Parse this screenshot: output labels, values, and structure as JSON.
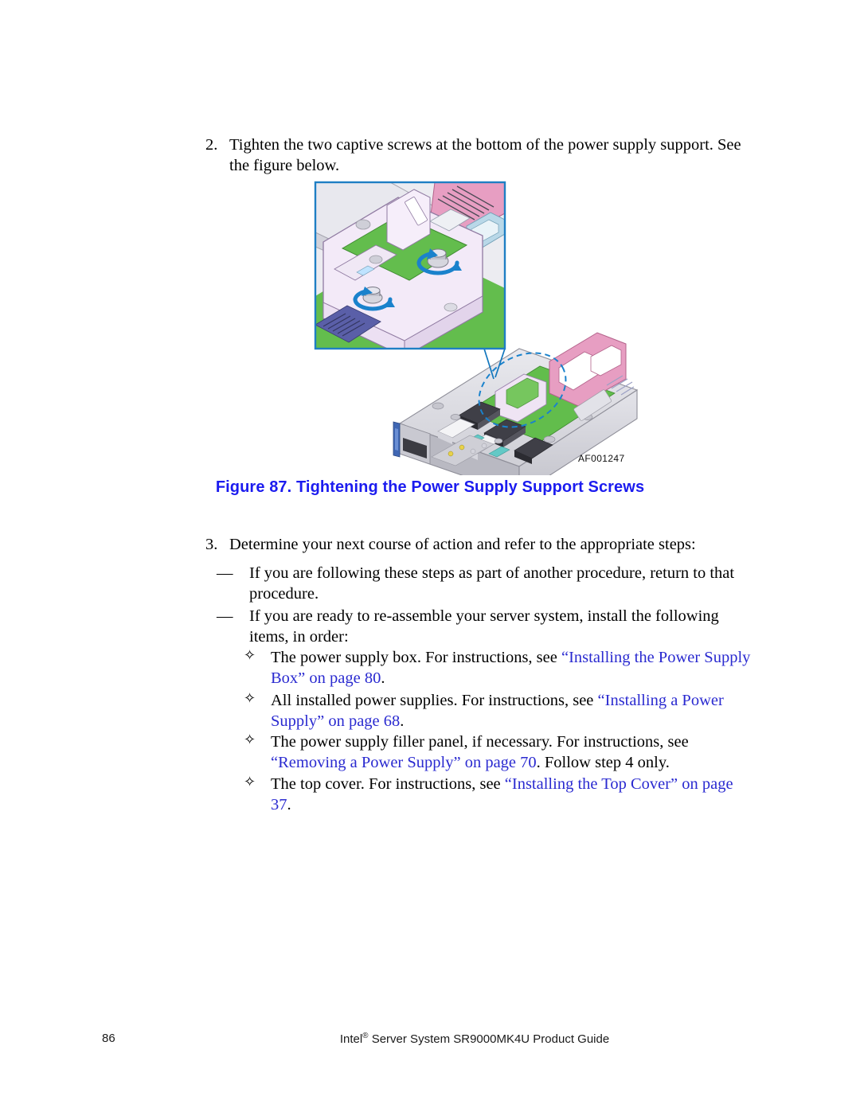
{
  "document": {
    "page_number": "86",
    "footer_title_prefix": "Intel",
    "footer_title_reg": "®",
    "footer_title_suffix": " Server System SR9000MK4U Product Guide"
  },
  "steps": [
    {
      "number": "2.",
      "text": "Tighten the two captive screws at the bottom of the power supply support. See the figure below."
    },
    {
      "number": "3.",
      "text": "Determine your next course of action and refer to the appropriate steps:"
    }
  ],
  "dash_bullets": [
    {
      "marker": "—",
      "text": "If you are following these steps as part of another procedure, return to that procedure."
    },
    {
      "marker": "—",
      "text": "If you are ready to re-assemble your server system, install the following items, in order:"
    }
  ],
  "diamond_bullets": [
    {
      "marker": "✧",
      "lead": "The power supply box. For instructions, see ",
      "link": "“Installing the Power Supply Box” on page 80",
      "tail": "."
    },
    {
      "marker": "✧",
      "lead": "All installed power supplies. For instructions, see ",
      "link": "“Installing a Power Supply” on page 68",
      "tail": "."
    },
    {
      "marker": "✧",
      "lead": "The power supply filler panel, if necessary. For instructions, see ",
      "link": "“Removing a Power Supply” on page 70",
      "tail": ". Follow step 4 only."
    },
    {
      "marker": "✧",
      "lead": "The top cover. For instructions, see ",
      "link": "“Installing the Top Cover” on page 37",
      "tail": "."
    }
  ],
  "figure": {
    "caption": "Figure 87. Tightening the Power Supply Support Screws",
    "artwork_id": "AF001247",
    "caption_color": "#1b1bef",
    "link_color": "#2a2ad0",
    "callout_border_color": "#1f7fc4",
    "leader_line_color": "#1176bd",
    "arrow_color": "#1a82cc",
    "pcb_green": "#5fba4a",
    "chassis_gray": "#d8d8dc",
    "riser_pink": "#e58fb8",
    "support_lavender": "#e8dcf0"
  }
}
